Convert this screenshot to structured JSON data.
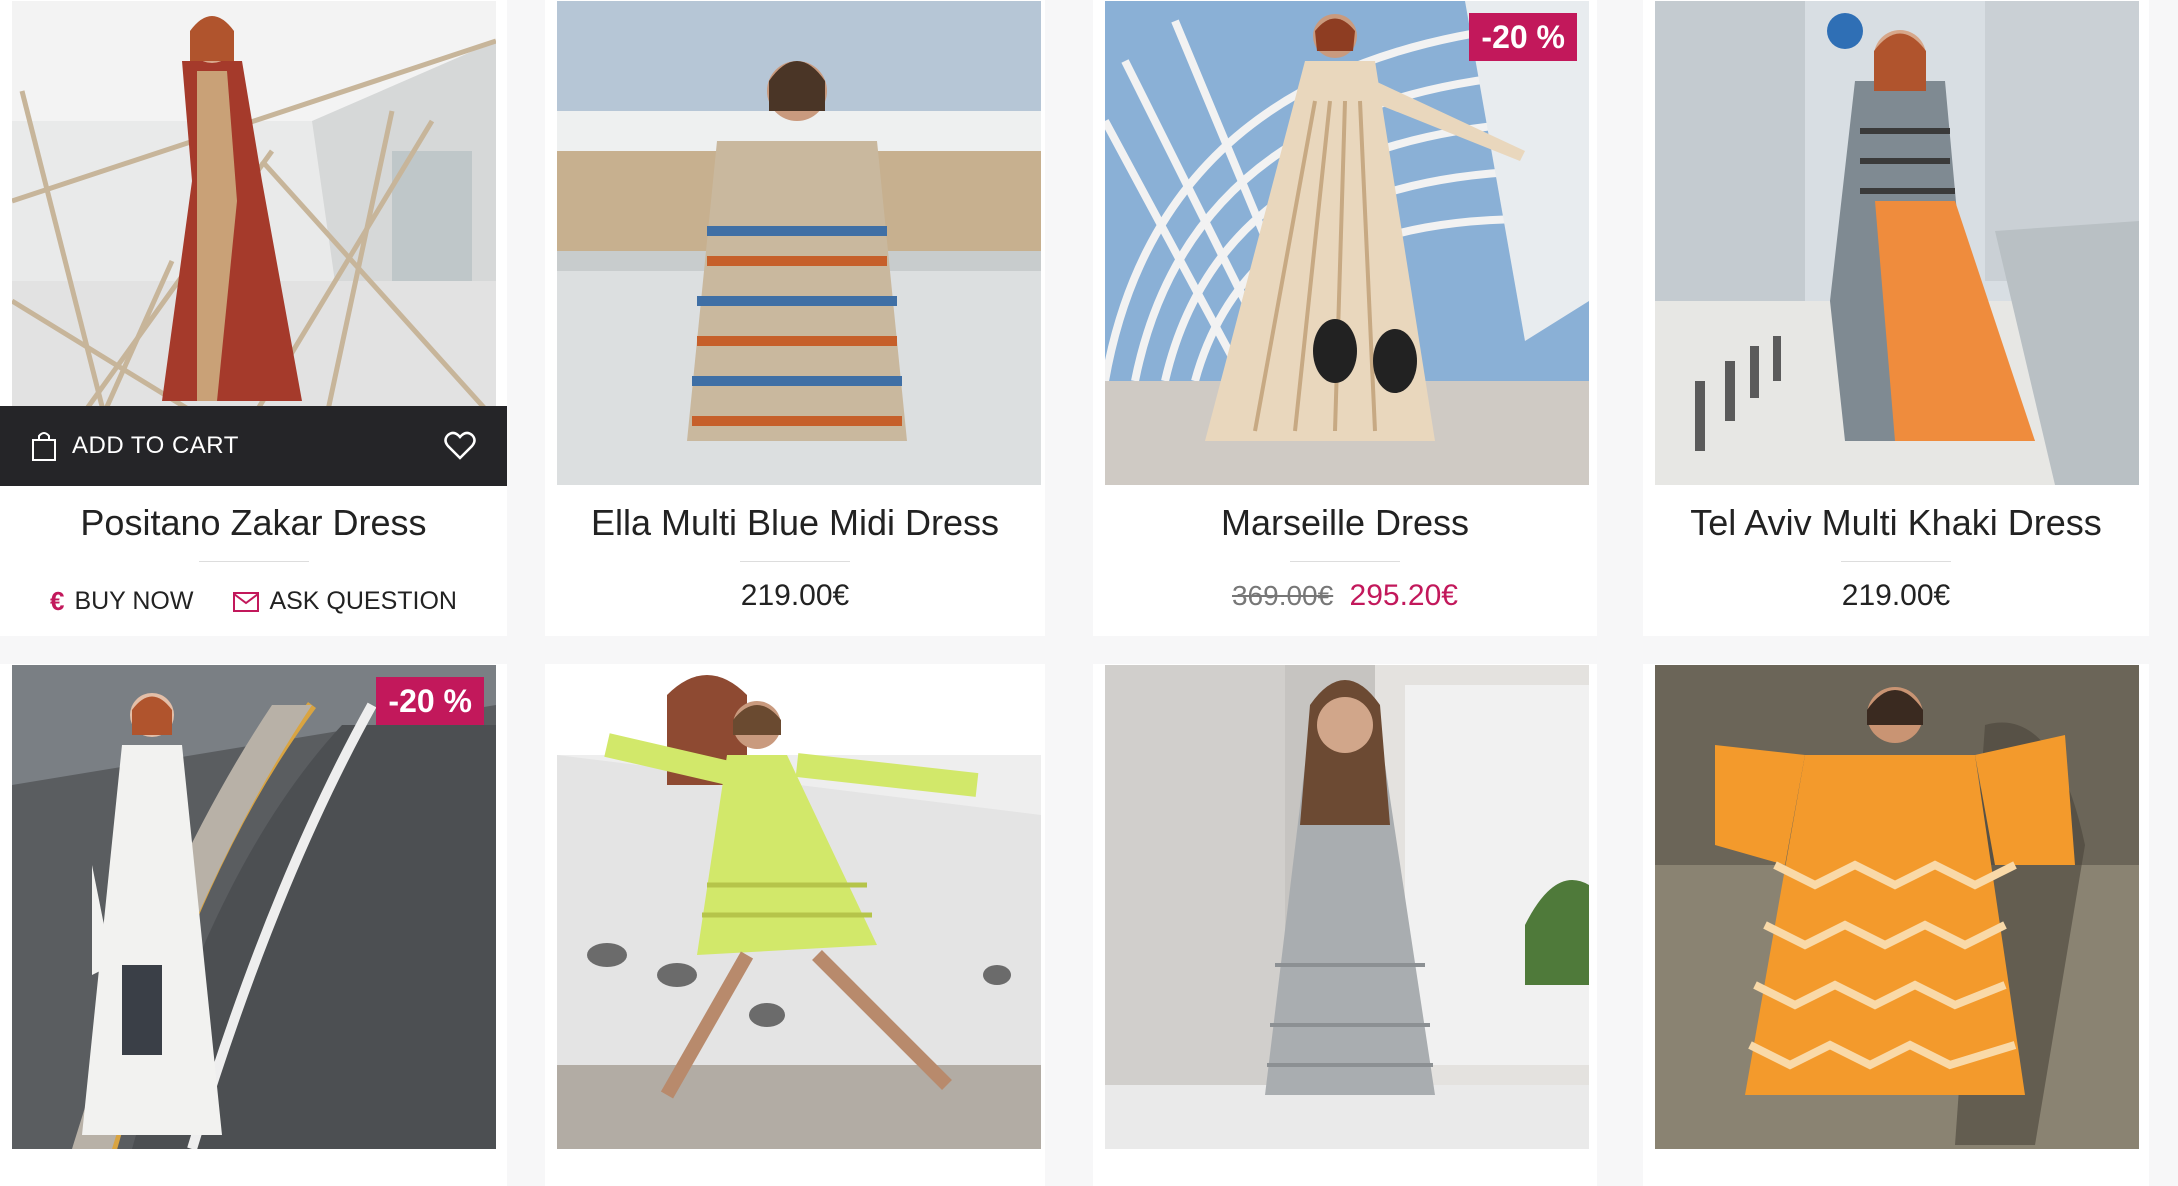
{
  "colors": {
    "accent": "#c2185b",
    "dark_bar": "#252528",
    "background": "#f7f7f8"
  },
  "products": [
    {
      "name": "Positano Zakar Dress",
      "add_to_cart": "ADD TO CART",
      "buy_now": "BUY NOW",
      "ask_question": "ASK QUESTION",
      "icons": [
        "shopping-bag-icon",
        "heart-icon",
        "euro-icon",
        "mail-icon"
      ]
    },
    {
      "name": "Ella Multi Blue Midi Dress",
      "price": "219.00€"
    },
    {
      "name": "Marseille Dress",
      "badge": "-20 %",
      "old_price": "369.00€",
      "price": "295.20€"
    },
    {
      "name": "Tel Aviv Multi Khaki Dress",
      "price": "219.00€"
    },
    {
      "badge": "-20 %"
    },
    {},
    {},
    {}
  ]
}
